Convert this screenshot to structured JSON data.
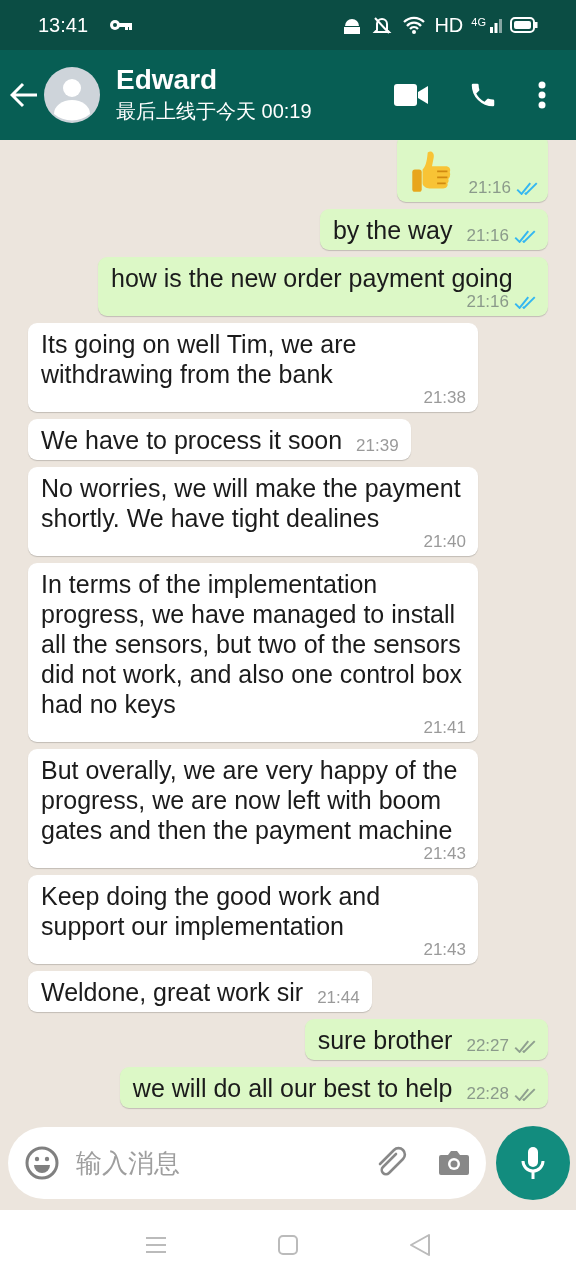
{
  "status_bar": {
    "time": "13:41",
    "hd": "HD",
    "network": "4G"
  },
  "header": {
    "name": "Edward",
    "last_seen": "最后上线于今天 00:19"
  },
  "messages": [
    {
      "kind": "emoji",
      "outgoing": true,
      "time": "21:16",
      "read": true
    },
    {
      "kind": "text",
      "outgoing": true,
      "text": "by the way",
      "time": "21:16",
      "read": true
    },
    {
      "kind": "text",
      "outgoing": true,
      "text": "how is the new order payment going",
      "time": "21:16",
      "read": true
    },
    {
      "kind": "text",
      "outgoing": false,
      "text": "Its going on well Tim, we are withdrawing from the bank",
      "time": "21:38"
    },
    {
      "kind": "text",
      "outgoing": false,
      "text": "We have to process it soon",
      "time": "21:39"
    },
    {
      "kind": "text",
      "outgoing": false,
      "text": "No worries, we will make the payment shortly. We have tight dealines",
      "time": "21:40"
    },
    {
      "kind": "text",
      "outgoing": false,
      "text": "In terms of the implementation progress, we have managed to install all the sensors, but two of the sensors did not work, and also one control box had no keys",
      "time": "21:41"
    },
    {
      "kind": "text",
      "outgoing": false,
      "text": "But overally, we are very happy of the progress, we are now left with boom gates and then the payment machine",
      "time": "21:43"
    },
    {
      "kind": "text",
      "outgoing": false,
      "text": "Keep doing the good work and support our implementation",
      "time": "21:43"
    },
    {
      "kind": "text",
      "outgoing": false,
      "text": "Weldone, great work sir",
      "time": "21:44"
    },
    {
      "kind": "text",
      "outgoing": true,
      "text": "sure brother",
      "time": "22:27",
      "read": false
    },
    {
      "kind": "text",
      "outgoing": true,
      "text": "we will do all our best to help",
      "time": "22:28",
      "read": false
    }
  ],
  "composer": {
    "placeholder": "输入消息"
  }
}
